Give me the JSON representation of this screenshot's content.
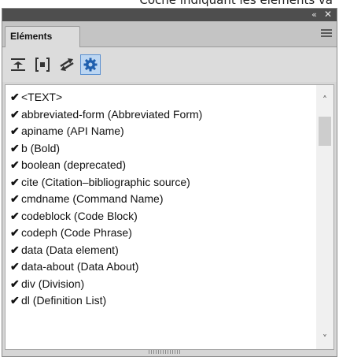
{
  "caption": "Coche indiquant les éléments va",
  "panel": {
    "collapse_icon": "double-chevron-left-icon",
    "collapse_glyph": "«",
    "close_glyph": "✕",
    "tab_label": "Eléments",
    "menu_icon": "panel-menu-icon"
  },
  "toolbar": {
    "tools": [
      {
        "icon": "collapse-rows-icon",
        "active": false
      },
      {
        "icon": "bracketed-element-icon",
        "active": false
      },
      {
        "icon": "swap-arrows-icon",
        "active": false
      },
      {
        "icon": "gear-settings-icon",
        "active": true
      }
    ]
  },
  "elements": {
    "check_glyph": "✔",
    "items": [
      "<TEXT>",
      "abbreviated-form  (Abbreviated Form)",
      "apiname  (API Name)",
      "b  (Bold)",
      "boolean  (deprecated)",
      "cite  (Citation–bibliographic source)",
      "cmdname  (Command Name)",
      "codeblock  (Code Block)",
      "codeph  (Code Phrase)",
      "data  (Data element)",
      "data-about  (Data About)",
      "div  (Division)",
      "dl  (Definition List)"
    ]
  },
  "scrollbar": {
    "up_glyph": "˄",
    "down_glyph": "˅"
  }
}
